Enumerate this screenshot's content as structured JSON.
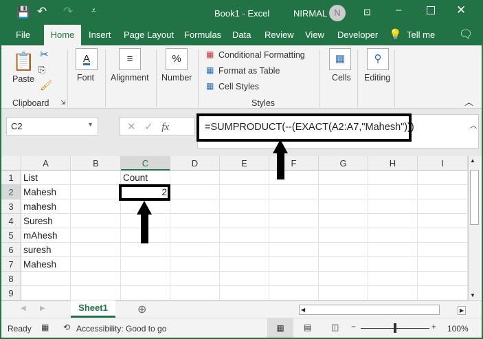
{
  "title_bar": {
    "doc_title": "Book1  -  Excel",
    "user_name": "NIRMAL",
    "avatar_initial": "N"
  },
  "tabs": [
    "File",
    "Home",
    "Insert",
    "Page Layout",
    "Formulas",
    "Data",
    "Review",
    "View",
    "Developer",
    "Tell me"
  ],
  "ribbon": {
    "paste": "Paste",
    "clipboard": "Clipboard",
    "font": "Font",
    "alignment": "Alignment",
    "number": "Number",
    "conditional_formatting": "Conditional Formatting",
    "format_as_table": "Format as Table",
    "cell_styles": "Cell Styles",
    "styles": "Styles",
    "cells": "Cells",
    "editing": "Editing",
    "font_glyph": "A",
    "number_glyph": "%"
  },
  "formula_bar": {
    "name_box": "C2",
    "fx": "fx",
    "formula": "=SUMPRODUCT(--(EXACT(A2:A7,\"Mahesh\")))"
  },
  "columns": [
    "A",
    "B",
    "C",
    "D",
    "E",
    "F",
    "G",
    "H",
    "I"
  ],
  "rows": [
    "1",
    "2",
    "3",
    "4",
    "5",
    "6",
    "7",
    "8",
    "9"
  ],
  "cells": {
    "A1": "List",
    "C1": "Count",
    "A2": "Mahesh",
    "C2": "2",
    "A3": "mahesh",
    "A4": "Suresh",
    "A5": "mAhesh",
    "A6": "suresh",
    "A7": "Mahesh"
  },
  "sheet_tabs": [
    "Sheet1"
  ],
  "status": {
    "ready": "Ready",
    "accessibility": "Accessibility: Good to go",
    "zoom": "100%"
  },
  "colors": {
    "brand": "#217346"
  }
}
